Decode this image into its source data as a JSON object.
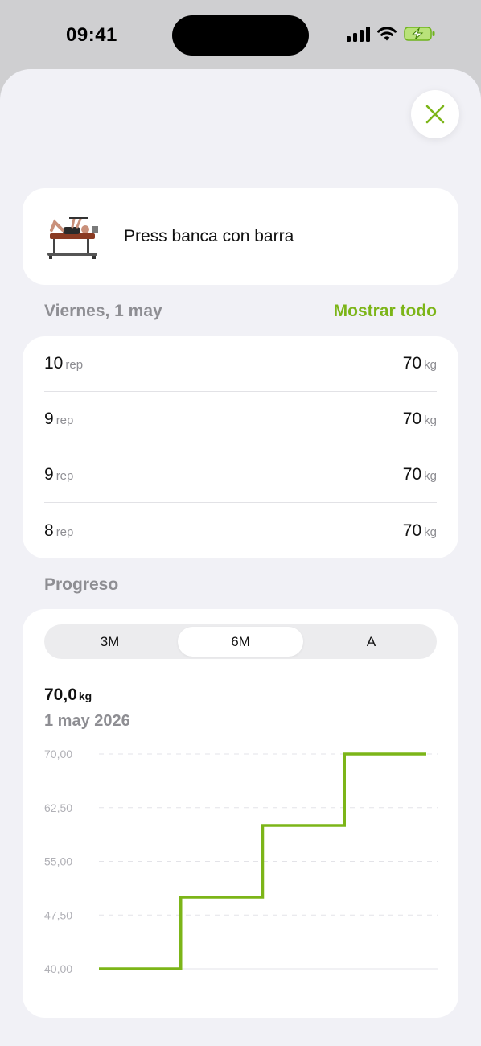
{
  "status_bar": {
    "time": "09:41"
  },
  "exercise": {
    "name": "Press banca con barra"
  },
  "session": {
    "date_label": "Viernes, 1 may",
    "show_all": "Mostrar todo",
    "sets": [
      {
        "reps": "10",
        "reps_unit": "rep",
        "weight": "70",
        "weight_unit": "kg"
      },
      {
        "reps": "9",
        "reps_unit": "rep",
        "weight": "70",
        "weight_unit": "kg"
      },
      {
        "reps": "9",
        "reps_unit": "rep",
        "weight": "70",
        "weight_unit": "kg"
      },
      {
        "reps": "8",
        "reps_unit": "rep",
        "weight": "70",
        "weight_unit": "kg"
      }
    ]
  },
  "progress": {
    "title": "Progreso",
    "tabs": [
      "3M",
      "6M",
      "A"
    ],
    "selected_tab": "6M",
    "current_value": "70,0",
    "current_unit": "kg",
    "current_date": "1 may 2026"
  },
  "colors": {
    "accent": "#7cb518",
    "secondary_text": "#8e8e93",
    "sheet_bg": "#f1f1f6"
  },
  "chart_data": {
    "type": "line",
    "step": true,
    "ylim": [
      40,
      70
    ],
    "y_ticks": [
      "70,00",
      "62,50",
      "55,00",
      "47,50",
      "40,00"
    ],
    "y_tick_values": [
      70,
      62.5,
      55,
      47.5,
      40
    ],
    "x": [
      0,
      1,
      2,
      3
    ],
    "series": [
      {
        "values": [
          40,
          50,
          60,
          70
        ]
      }
    ],
    "grid": true
  }
}
